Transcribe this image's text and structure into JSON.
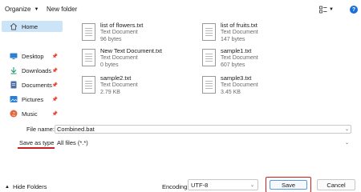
{
  "toolbar": {
    "organize_label": "Organize",
    "new_folder_label": "New folder",
    "help_label": "?"
  },
  "nav": {
    "items": [
      {
        "label": "Home",
        "icon": "home-icon",
        "selected": true
      },
      {
        "label": "Desktop",
        "icon": "desktop-icon",
        "pinned": true
      },
      {
        "label": "Downloads",
        "icon": "downloads-icon",
        "pinned": true
      },
      {
        "label": "Documents",
        "icon": "documents-icon",
        "pinned": true
      },
      {
        "label": "Pictures",
        "icon": "pictures-icon",
        "pinned": true
      },
      {
        "label": "Music",
        "icon": "music-icon",
        "pinned": true
      }
    ]
  },
  "files": [
    {
      "name": "list of flowers.txt",
      "type": "Text Document",
      "size": "96 bytes"
    },
    {
      "name": "list of fruits.txt",
      "type": "Text Document",
      "size": "147 bytes"
    },
    {
      "name": "New Text Document.txt",
      "type": "Text Document",
      "size": "0 bytes"
    },
    {
      "name": "sample1.txt",
      "type": "Text Document",
      "size": "607 bytes"
    },
    {
      "name": "sample2.txt",
      "type": "Text Document",
      "size": "2.79 KB"
    },
    {
      "name": "sample3.txt",
      "type": "Text Document",
      "size": "3.45 KB"
    }
  ],
  "save_form": {
    "file_name_label": "File name:",
    "file_name_value": "Combined.bat",
    "save_as_type_label": "Save as type:",
    "save_as_type_value": "All files  (*.*)",
    "hide_folders_label": "Hide Folders",
    "encoding_label": "Encoding:",
    "encoding_value": "UTF-8",
    "save_label": "Save",
    "cancel_label": "Cancel"
  },
  "colors": {
    "highlight_red": "#d21e1e",
    "selection_blue": "#cce4f7",
    "accent_blue": "#1a6fd6"
  }
}
